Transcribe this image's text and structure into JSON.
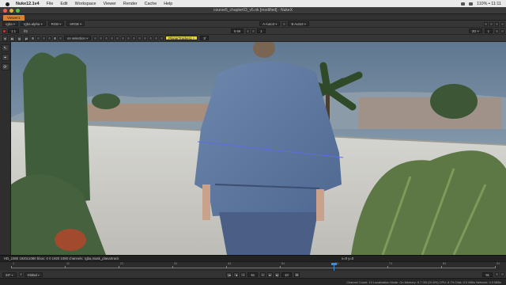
{
  "menubar": {
    "app": "Nuke12.1v4",
    "items": [
      "File",
      "Edit",
      "Workspace",
      "Viewer",
      "Render",
      "Cache",
      "Help"
    ],
    "status": "110% ▪ 11:11"
  },
  "window": {
    "title": "course5_chapter03_v5.nk [modified] - NukeX"
  },
  "viewer_tab": {
    "label": "Viewer1"
  },
  "toolbar1": {
    "layer": "rgba",
    "channel": "rgba.alpha",
    "display": "RGB",
    "lut": "sRGB",
    "input_a": "A  Auto3",
    "input_b": "B  Auto3"
  },
  "toolbar2": {
    "frame_field": "1:1",
    "gain_value": "0.66",
    "gamma_value": "1",
    "proxy": "2D",
    "frame_number": "1"
  },
  "toolbar3": {
    "mode": "on selection",
    "node": "PlanarTracker1",
    "frame_range": "1f"
  },
  "tools": [
    "↖",
    "⌖",
    "⟳"
  ],
  "infobar": {
    "text": "HD_1080 1920x1080  bbox: 0 0 1920 1080 channels: rgba,mask_planartrack",
    "coords": "x=0 y=0"
  },
  "timeline": {
    "labels": [
      "1",
      "11",
      "21",
      "31",
      "41",
      "51",
      "61",
      "71",
      "81",
      "91"
    ],
    "current_frame": 61
  },
  "transport": {
    "fps": "24*",
    "global": "Global",
    "frame": "61",
    "step": "10",
    "end": "91"
  },
  "statusbar": {
    "text": "Channel Count: 19  Localization Mode: On  Memory: 6.7 GB (20.6%)  CPU: 8.7%  Disk: 0.0 MB/s  Network: 0.0 MB/s"
  },
  "colors": {
    "accent": "#d9822b",
    "playhead": "#3c8ed8",
    "track_line": "#5d6ee0"
  }
}
